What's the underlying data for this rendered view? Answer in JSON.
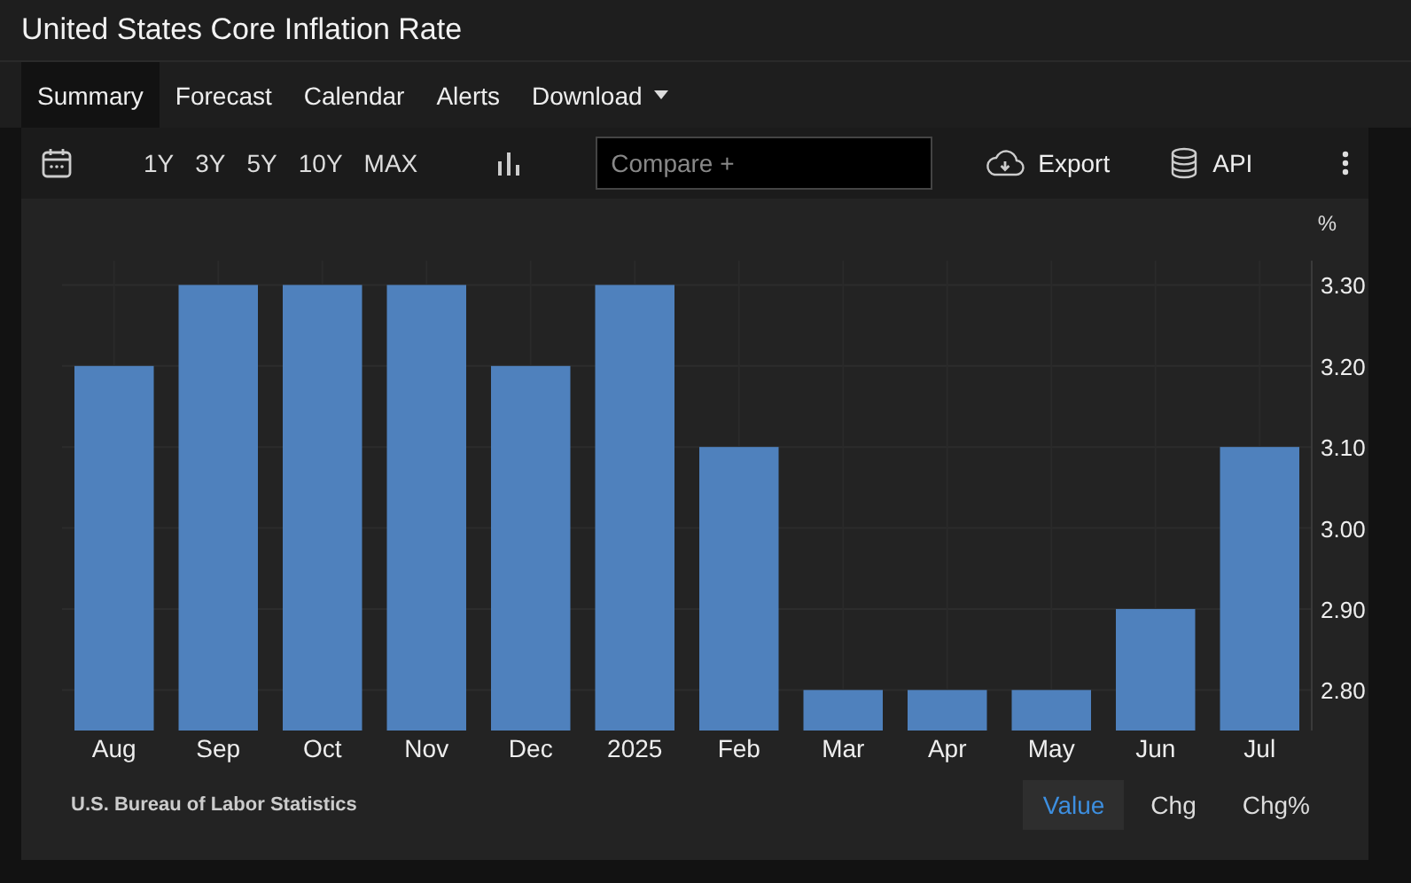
{
  "window": {
    "title": "United States Core Inflation Rate"
  },
  "tabs": [
    {
      "label": "Summary",
      "selected": true,
      "dropdown": false
    },
    {
      "label": "Forecast",
      "selected": false,
      "dropdown": false
    },
    {
      "label": "Calendar",
      "selected": false,
      "dropdown": false
    },
    {
      "label": "Alerts",
      "selected": false,
      "dropdown": false
    },
    {
      "label": "Download",
      "selected": false,
      "dropdown": true
    }
  ],
  "toolbar": {
    "ranges": [
      "1Y",
      "3Y",
      "5Y",
      "10Y",
      "MAX"
    ],
    "compare": {
      "placeholder": "Compare +"
    },
    "export": "Export",
    "api": "API"
  },
  "chart": {
    "unit": "%",
    "chart_data": {
      "type": "bar",
      "categories": [
        "Aug",
        "Sep",
        "Oct",
        "Nov",
        "Dec",
        "2025",
        "Feb",
        "Mar",
        "Apr",
        "May",
        "Jun",
        "Jul"
      ],
      "grid": true,
      "series": [
        {
          "color": "#4f81bd",
          "values": [
            3.2,
            3.3,
            3.3,
            3.3,
            3.2,
            3.3,
            3.1,
            2.8,
            2.8,
            2.8,
            2.9,
            3.1
          ]
        }
      ],
      "ylim": [
        2.75,
        3.33
      ],
      "yticks": [
        {
          "value": 2.8,
          "label": "2.80"
        },
        {
          "value": 2.9,
          "label": "2.90"
        },
        {
          "value": 3.0,
          "label": "3.00"
        },
        {
          "value": 3.1,
          "label": "3.10"
        },
        {
          "value": 3.2,
          "label": "3.20"
        },
        {
          "value": 3.3,
          "label": "3.30"
        }
      ]
    }
  },
  "source": "U.S. Bureau of Labor Statistics",
  "view_buttons": [
    {
      "label": "Value",
      "selected": true
    },
    {
      "label": "Chg",
      "selected": false
    },
    {
      "label": "Chg%",
      "selected": false
    }
  ]
}
